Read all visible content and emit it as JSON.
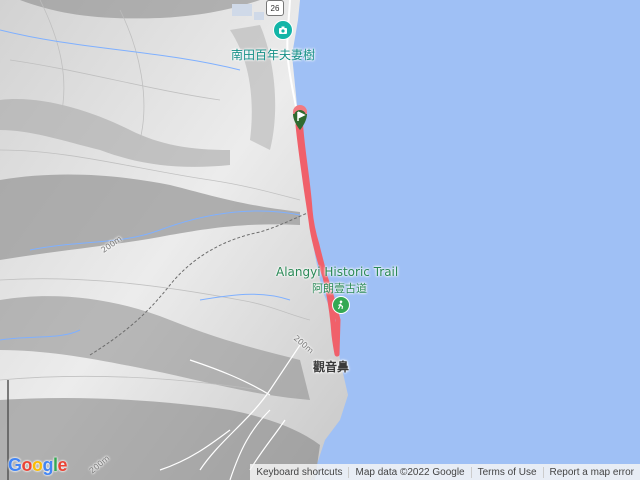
{
  "map": {
    "labels": {
      "tree": "南田百年夫妻樹",
      "trail_en": "Alangyi Historic Trail",
      "trail_zh": "阿朗壹古道",
      "cape": "觀音鼻",
      "road": "26",
      "elev1": "200m",
      "elev2": "200m",
      "elev3": "200m"
    },
    "colors": {
      "sea": "#9fc0f5",
      "track": "#f0606a",
      "land": "#e6e6e6"
    }
  },
  "footer": {
    "logo": "Google",
    "shortcuts": "Keyboard shortcuts",
    "mapdata": "Map data ©2022 Google",
    "terms": "Terms of Use",
    "report": "Report a map error"
  }
}
